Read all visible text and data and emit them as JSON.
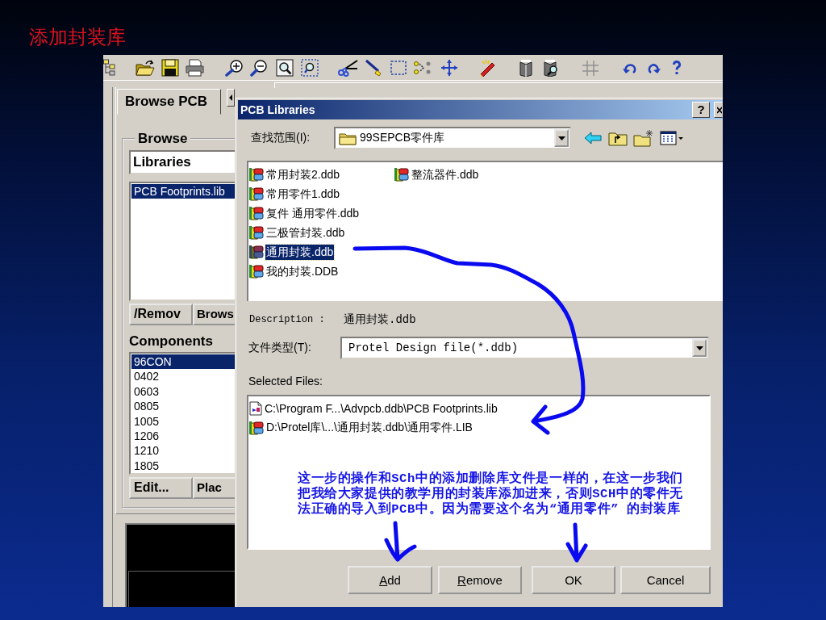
{
  "slide": {
    "title": "添加封装库"
  },
  "browse_panel": {
    "tab": {
      "label": "Browse PCB",
      "selected": true
    },
    "group_label": "Browse",
    "browse_type": "Libraries",
    "libraries": [
      {
        "name": "PCB Footprints.lib",
        "selected": true
      }
    ],
    "library_buttons": [
      "/Remov",
      "Brows"
    ],
    "components_label": "Components",
    "components": [
      {
        "name": "96CON",
        "selected": true
      },
      {
        "name": "0402",
        "selected": false
      },
      {
        "name": "0603",
        "selected": false
      },
      {
        "name": "0805",
        "selected": false
      },
      {
        "name": "1005",
        "selected": false
      },
      {
        "name": "1206",
        "selected": false
      },
      {
        "name": "1210",
        "selected": false
      },
      {
        "name": "1805",
        "selected": false
      }
    ],
    "component_buttons": [
      "Edit...",
      "Plac"
    ]
  },
  "dialog": {
    "title": "PCB Libraries",
    "help_button": "?",
    "look_in_label": "查找范围(I):",
    "look_in_value": "99SEPCB零件库",
    "files": [
      {
        "name": "常用封装2.ddb",
        "selected": false
      },
      {
        "name": "常用零件1.ddb",
        "selected": false
      },
      {
        "name": "复件 通用零件.ddb",
        "selected": false
      },
      {
        "name": "三极管封装.ddb",
        "selected": false
      },
      {
        "name": "通用封装.ddb",
        "selected": true
      },
      {
        "name": "我的封装.DDB",
        "selected": false
      },
      {
        "name": "整流器件.ddb",
        "selected": false
      }
    ],
    "description_label": "Description :",
    "description_value": "通用封装.ddb",
    "file_type_label": "文件类型(T):",
    "file_type_value": "Protel Design file(*.ddb)",
    "selected_files_label": "Selected Files:",
    "selected_files": [
      {
        "path": "C:\\Program F...\\Advpcb.ddb\\PCB Footprints.lib",
        "kind": "document"
      },
      {
        "path": "D:\\Protel库\\...\\通用封装.ddb\\通用零件.LIB",
        "kind": "database"
      }
    ],
    "overlay_note": "这一步的操作和SCh中的添加删除库文件是一样的，在这一步我们把我给大家提供的教学用的封装库添加进来，否则SCH中的零件无法正确的导入到PCB中。因为需要这个名为“通用零件” 的封装库",
    "buttons": [
      {
        "label": "Add",
        "access_key_underlined": true
      },
      {
        "label": "Remove",
        "access_key_underlined": true
      },
      {
        "label": "OK",
        "access_key_underlined": false
      },
      {
        "label": "Cancel",
        "access_key_underlined": false
      }
    ]
  }
}
